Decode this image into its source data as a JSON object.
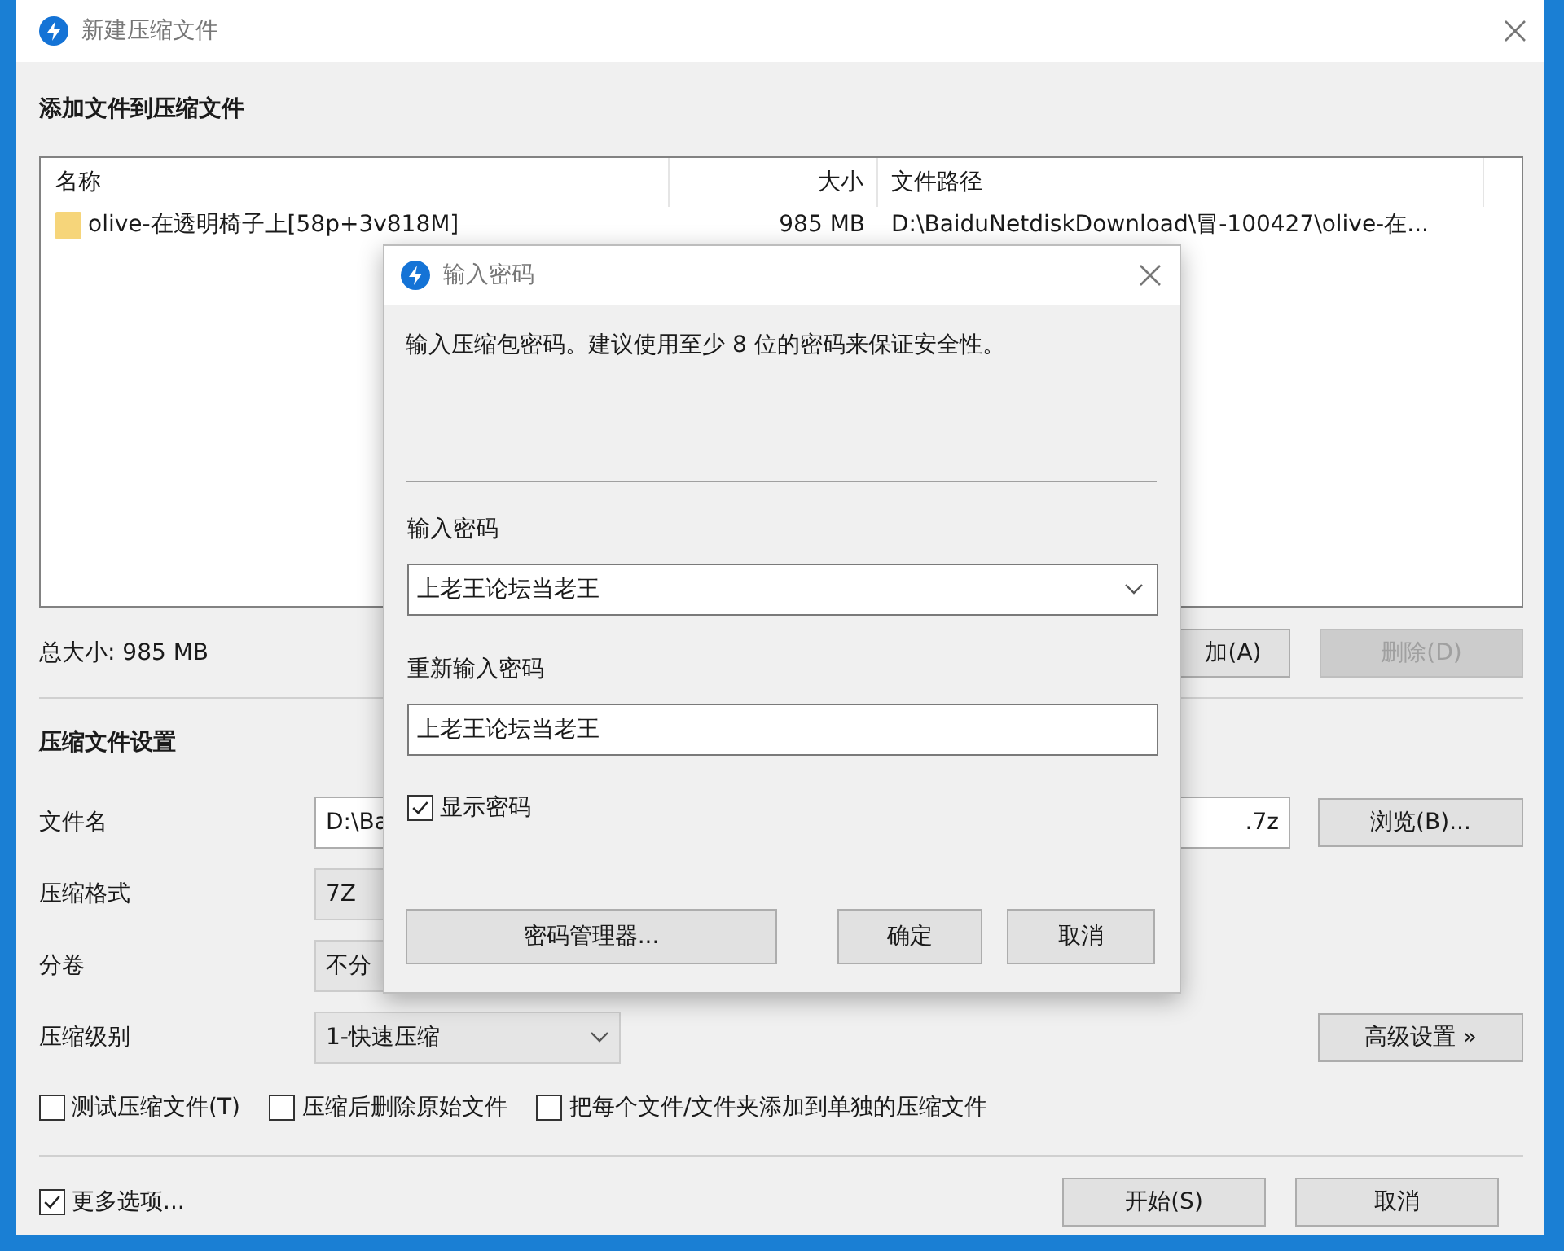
{
  "main_window": {
    "title": "新建压缩文件",
    "heading": "添加文件到压缩文件",
    "file_list": {
      "columns": [
        "名称",
        "大小",
        "文件路径"
      ],
      "rows": [
        {
          "name": "olive-在透明椅子上[58p+3v818M]",
          "size": "985 MB",
          "path": "D:\\BaiduNetdiskDownload\\冒-100427\\olive-在..."
        }
      ]
    },
    "total_size": "总大小: 985 MB",
    "list_buttons": [
      {
        "label": "加(A)",
        "disabled": false
      },
      {
        "label": "删除(D)",
        "disabled": true
      }
    ],
    "settings_heading": "压缩文件设置",
    "settings": [
      {
        "label": "文件名",
        "kind": "text",
        "value": "D:\\Ba",
        "value_end": ".7z",
        "button": "浏览(B)..."
      },
      {
        "label": "压缩格式",
        "kind": "box",
        "value": "7Z"
      },
      {
        "label": "分卷",
        "kind": "box",
        "value": "不分"
      },
      {
        "label": "压缩级别",
        "kind": "dropdown",
        "value": "1-快速压缩",
        "button": "高级设置 »"
      }
    ],
    "options": [
      {
        "label": "测试压缩文件(T)",
        "checked": false
      },
      {
        "label": "压缩后删除原始文件",
        "checked": false
      },
      {
        "label": "把每个文件/文件夹添加到单独的压缩文件",
        "checked": false
      }
    ],
    "more_options": {
      "label": "更多选项...",
      "checked": true
    },
    "buttons": [
      "开始(S)",
      "取消"
    ]
  },
  "password_dialog": {
    "title": "输入密码",
    "message": "输入压缩包密码。建议使用至少 8 位的密码来保证安全性。",
    "password_label": "输入密码",
    "password": "上老王论坛当老王",
    "confirm_label": "重新输入密码",
    "confirm": "上老王论坛当老王",
    "show_password": {
      "label": "显示密码",
      "checked": true
    },
    "manager_button": "密码管理器...",
    "buttons": [
      "确定",
      "取消"
    ]
  }
}
